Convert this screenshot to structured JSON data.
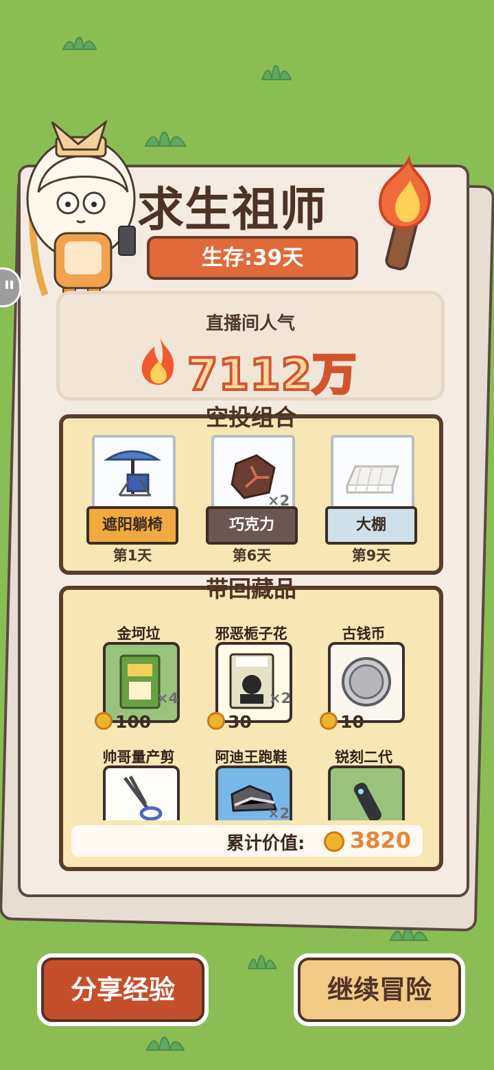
{
  "title": "求生祖师",
  "survival_days": "生存:39天",
  "popularity": {
    "label": "直播间人气",
    "value": "7112万"
  },
  "airdrop": {
    "title": "空投组合",
    "items": [
      {
        "label": "遮阳躺椅",
        "day": "第1天",
        "qty": ""
      },
      {
        "label": "巧克力",
        "day": "第6天",
        "qty": "×2"
      },
      {
        "label": "大棚",
        "day": "第9天",
        "qty": ""
      }
    ]
  },
  "collection": {
    "title": "带回藏品",
    "items": [
      {
        "name": "金坷垃",
        "value": "100",
        "qty": "×4",
        "icon": "bag-icon"
      },
      {
        "name": "邪恶栀子花",
        "value": "30",
        "qty": "×2",
        "icon": "book-icon"
      },
      {
        "name": "古钱币",
        "value": "10",
        "qty": "",
        "icon": "coin-icon"
      },
      {
        "name": "帅哥量产剪",
        "value": "",
        "qty": "",
        "icon": "scissors-icon"
      },
      {
        "name": "阿迪王跑鞋",
        "value": "",
        "qty": "×2",
        "icon": "shoe-icon"
      },
      {
        "name": "锐刻二代",
        "value": "",
        "qty": "",
        "icon": "vape-icon"
      }
    ],
    "total_label": "累计价值:",
    "total_value": "3820"
  },
  "buttons": {
    "share": "分享经验",
    "continue": "继续冒险"
  },
  "colors": {
    "background": "#8bbd55",
    "paper": "#f4ece2",
    "accent_orange": "#e06a3a",
    "brown_border": "#5a3d2d",
    "cream_panel": "#f6e7b4"
  }
}
